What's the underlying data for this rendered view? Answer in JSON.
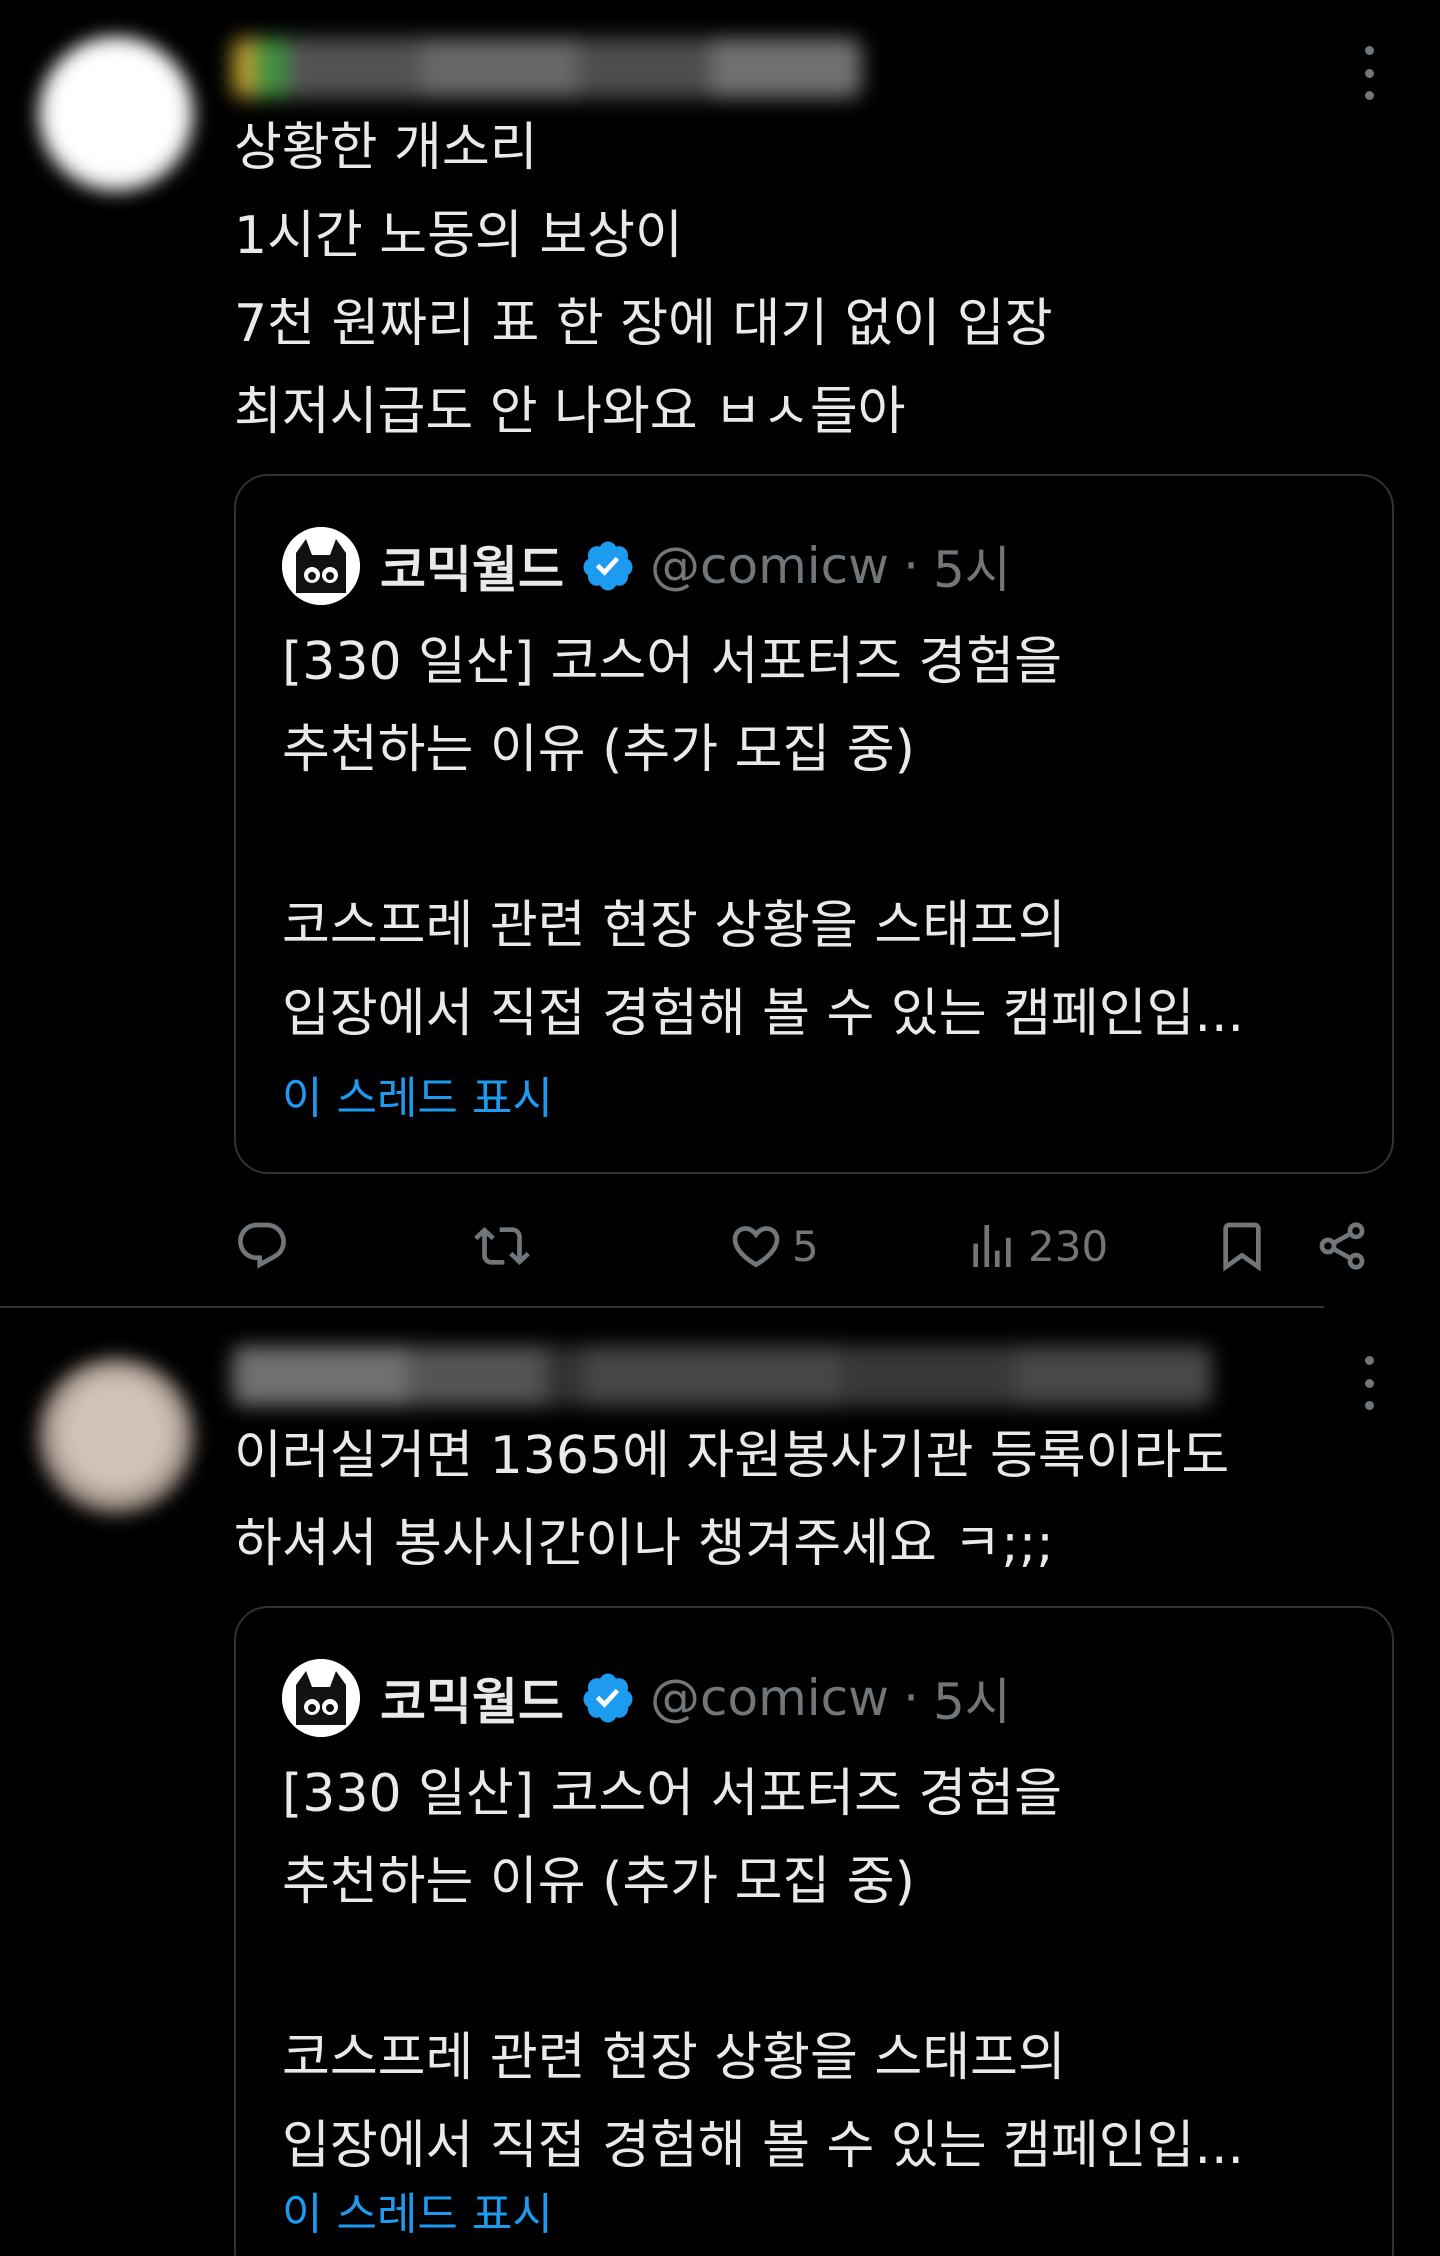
{
  "colors": {
    "background": "#000000",
    "text": "#e7e9ea",
    "muted": "#71767b",
    "border": "#2f3336",
    "link": "#1d9bf0",
    "verified": "#1d9bf0"
  },
  "posts": [
    {
      "text": "상황한 개소리\n1시간 노동의 보상이\n7천 원짜리 표 한 장에 대기 없이 입장\n최저시급도 안 나와요 ㅂㅅ들아",
      "quote": {
        "name": "코믹월드",
        "handle": "@comicw",
        "separator": "·",
        "time": "5시",
        "body": "[330 일산] 코스어 서포터즈 경험을\n추천하는 이유 (추가 모집 중)\n\n코스프레 관련 현장 상황을 스태프의\n입장에서 직접 경험해 볼 수 있는 캠페인입...",
        "show_thread": "이 스레드 표시"
      },
      "actions": {
        "reply_icon": "reply-icon",
        "repost_icon": "repost-icon",
        "like_icon": "heart-icon",
        "like_count": "5",
        "views_icon": "views-icon",
        "views_count": "230",
        "bookmark_icon": "bookmark-icon",
        "share_icon": "share-icon"
      }
    },
    {
      "text": "이러실거면 1365에 자원봉사기관 등록이라도\n하셔서 봉사시간이나 챙겨주세요 ㅋ;;;",
      "quote": {
        "name": "코믹월드",
        "handle": "@comicw",
        "separator": "·",
        "time": "5시",
        "body": "[330 일산] 코스어 서포터즈 경험을\n추천하는 이유 (추가 모집 중)\n\n코스프레 관련 현장 상황을 스태프의\n입장에서 직접 경험해 볼 수 있는 캠페인입...",
        "show_thread": "이 스레드 표시"
      }
    }
  ]
}
